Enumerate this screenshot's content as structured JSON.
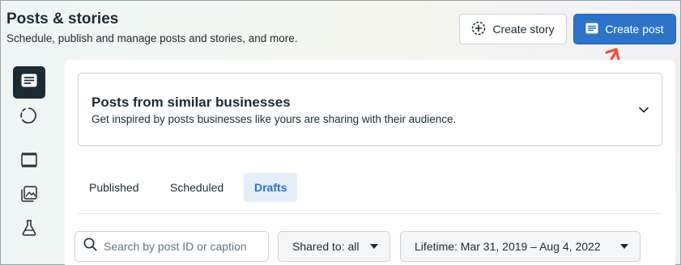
{
  "header": {
    "title": "Posts & stories",
    "subtitle": "Schedule, publish and manage posts and stories, and more."
  },
  "actions": {
    "create_story_label": "Create story",
    "create_post_label": "Create post"
  },
  "sidebar": {
    "items": [
      {
        "icon": "posts-icon",
        "active": true
      },
      {
        "icon": "stories-icon",
        "active": false
      },
      {
        "icon": "layout-icon",
        "active": false
      },
      {
        "icon": "media-icon",
        "active": false
      },
      {
        "icon": "flask-icon",
        "active": false
      }
    ]
  },
  "suggestions": {
    "title": "Posts from similar businesses",
    "subtitle": "Get inspired by posts businesses like yours are sharing with their audience."
  },
  "tabs": [
    {
      "label": "Published",
      "active": false
    },
    {
      "label": "Scheduled",
      "active": false
    },
    {
      "label": "Drafts",
      "active": true
    }
  ],
  "filters": {
    "search_placeholder": "Search by post ID or caption",
    "shared_to": "Shared to: all",
    "date_range": "Lifetime: Mar 31, 2019 – Aug 4, 2022"
  },
  "colors": {
    "accent": "#2d74c8",
    "annotation_arrow": "#e8503c"
  }
}
